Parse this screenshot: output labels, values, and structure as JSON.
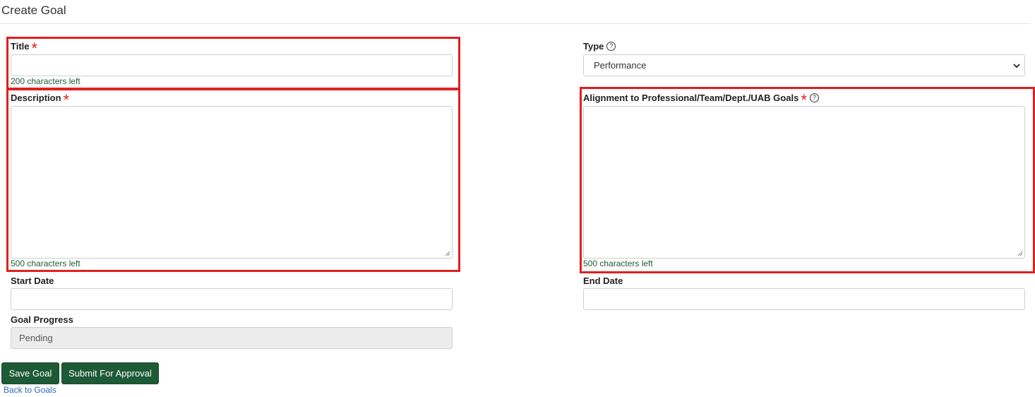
{
  "page": {
    "title": "Create Goal"
  },
  "form": {
    "title": {
      "label": "Title",
      "required_mark": "*",
      "value": "",
      "chars_left": "200 characters left"
    },
    "type": {
      "label": "Type",
      "help": "?",
      "selected": "Performance"
    },
    "description": {
      "label": "Description",
      "required_mark": "*",
      "value": "",
      "chars_left": "500 characters left"
    },
    "alignment": {
      "label": "Alignment to Professional/Team/Dept./UAB Goals",
      "required_mark": "*",
      "help": "?",
      "value": "",
      "chars_left": "500 characters left"
    },
    "start_date": {
      "label": "Start Date",
      "value": ""
    },
    "end_date": {
      "label": "End Date",
      "value": ""
    },
    "goal_progress": {
      "label": "Goal Progress",
      "value": "Pending"
    }
  },
  "actions": {
    "save_label": "Save Goal",
    "submit_label": "Submit For Approval",
    "back_label": "Back to Goals"
  },
  "colors": {
    "button_bg": "#1d5a36",
    "required": "#e02020",
    "highlight": "#e02020",
    "counter_text": "#1e5b34",
    "link": "#2a6ebb"
  },
  "icons": [
    "question-circle-icon",
    "chevron-down-icon",
    "resize-grip-icon"
  ]
}
